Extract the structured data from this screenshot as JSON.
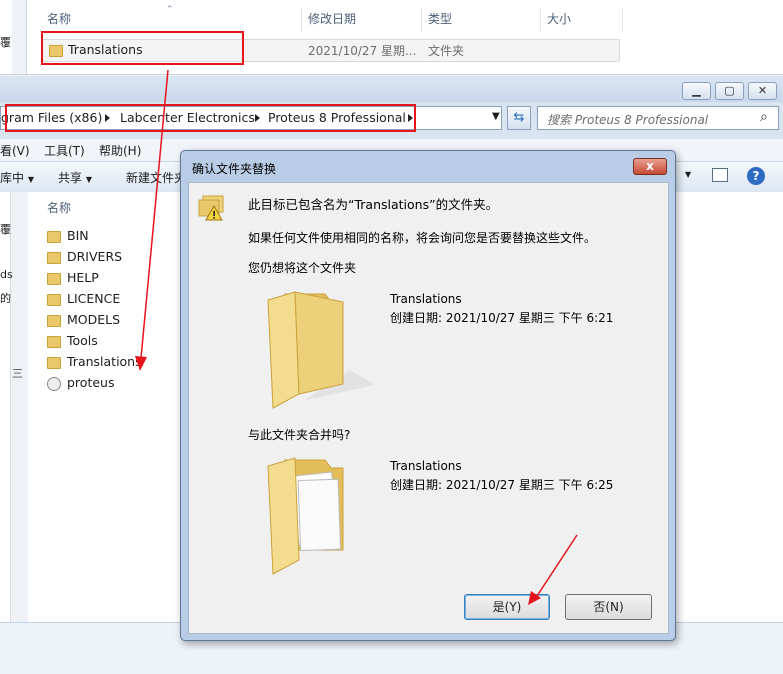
{
  "top_window": {
    "columns": [
      "名称",
      "修改日期",
      "类型",
      "大小"
    ],
    "row": {
      "name": "Translations",
      "date": "2021/10/27 星期...",
      "type": "文件夹"
    },
    "left_stub": "覆"
  },
  "main_window": {
    "breadcrumb": [
      "gram Files (x86)",
      "Labcenter Electronics",
      "Proteus 8 Professional"
    ],
    "search_placeholder": "搜索 Proteus 8 Professional",
    "menu": [
      "看(V)",
      "工具(T)",
      "帮助(H)"
    ],
    "toolbar": {
      "stub": "库中",
      "share": "共享",
      "new_folder": "新建文件夹"
    },
    "column_name": "名称",
    "items": [
      "BIN",
      "DRIVERS",
      "HELP",
      "LICENCE",
      "MODELS",
      "Tools",
      "Translations",
      "proteus"
    ],
    "left_stubs": [
      "覆",
      "ds",
      "的",
      "三"
    ]
  },
  "dialog": {
    "title": "确认文件夹替换",
    "close_label": "x",
    "message": "此目标已包含名为“Translations”的文件夹。",
    "info": "如果任何文件使用相同的名称，将会询问您是否要替换这些文件。",
    "prompt": "您仍想将这个文件夹",
    "source": {
      "name": "Translations",
      "created": "创建日期: 2021/10/27 星期三 下午 6:21"
    },
    "merge_question": "与此文件夹合并吗?",
    "target": {
      "name": "Translations",
      "created": "创建日期: 2021/10/27 星期三 下午 6:25"
    },
    "yes_button": "是(Y)",
    "no_button": "否(N)"
  },
  "colors": {
    "highlight_red": "#e8141c",
    "folder_yellow": "#e9c76a"
  }
}
